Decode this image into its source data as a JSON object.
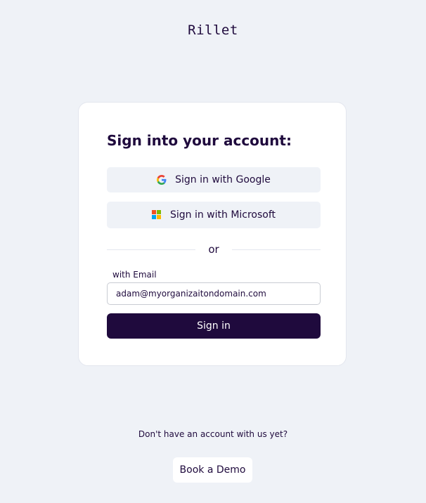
{
  "brand": {
    "logo_text": "Rillet"
  },
  "signin_card": {
    "title": "Sign into your account:",
    "google_button": {
      "label": "Sign in with Google",
      "icon": "google-icon"
    },
    "microsoft_button": {
      "label": "Sign in with Microsoft",
      "icon": "microsoft-icon"
    },
    "divider_text": "or",
    "email_label": "with Email",
    "email_value": "adam@myorganizaitondomain.com",
    "submit_label": "Sign in"
  },
  "footer": {
    "prompt": "Don't have an account with us yet?",
    "demo_label": "Book a Demo"
  },
  "colors": {
    "background": "#eff2f7",
    "primary": "#1f0a3d",
    "card": "#ffffff"
  }
}
